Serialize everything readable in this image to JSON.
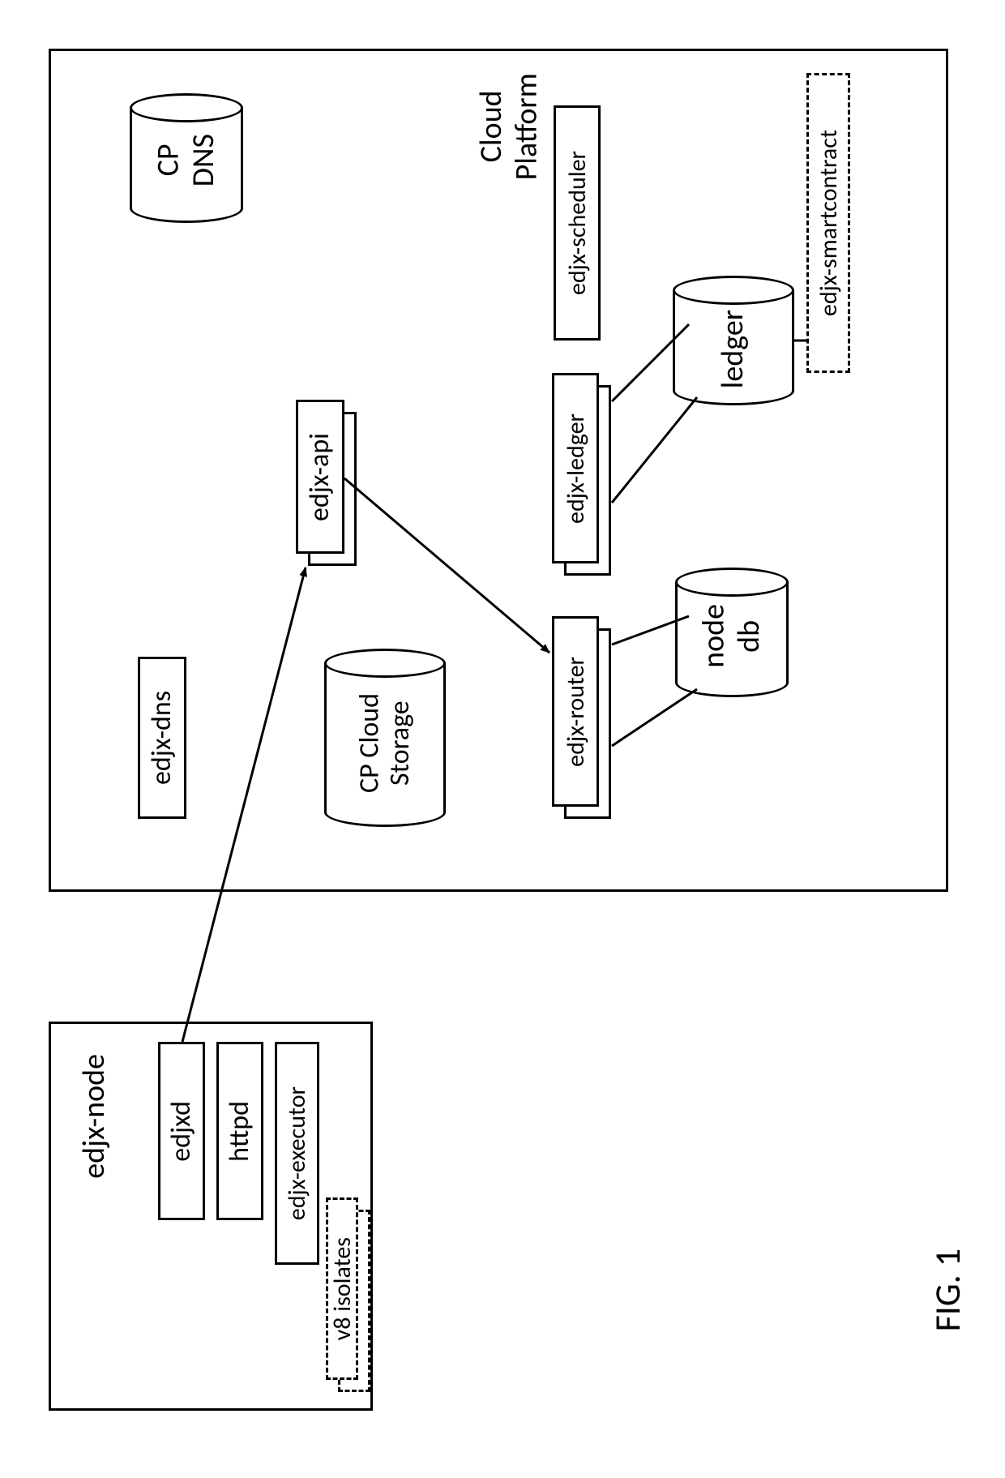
{
  "figure_caption": "FIG. 1",
  "cloud": {
    "title": "Cloud\nPlatform",
    "cp_dns": "CP\nDNS",
    "edjx_dns": "edjx-dns",
    "edjx_api": "edjx-api",
    "cp_cloud_storage": "CP Cloud\nStorage",
    "edjx_scheduler": "edjx-scheduler",
    "edjx_ledger": "edjx-ledger",
    "ledger": "ledger",
    "edjx_smartcontract": "edjx-smartcontract",
    "edjx_router": "edjx-router",
    "node_db": "node\ndb"
  },
  "node": {
    "title": "edjx-node",
    "edjxd": "edjxd",
    "httpd": "httpd",
    "edjx_executor": "edjx-executor",
    "v8_isolates": "v8 isolates"
  }
}
